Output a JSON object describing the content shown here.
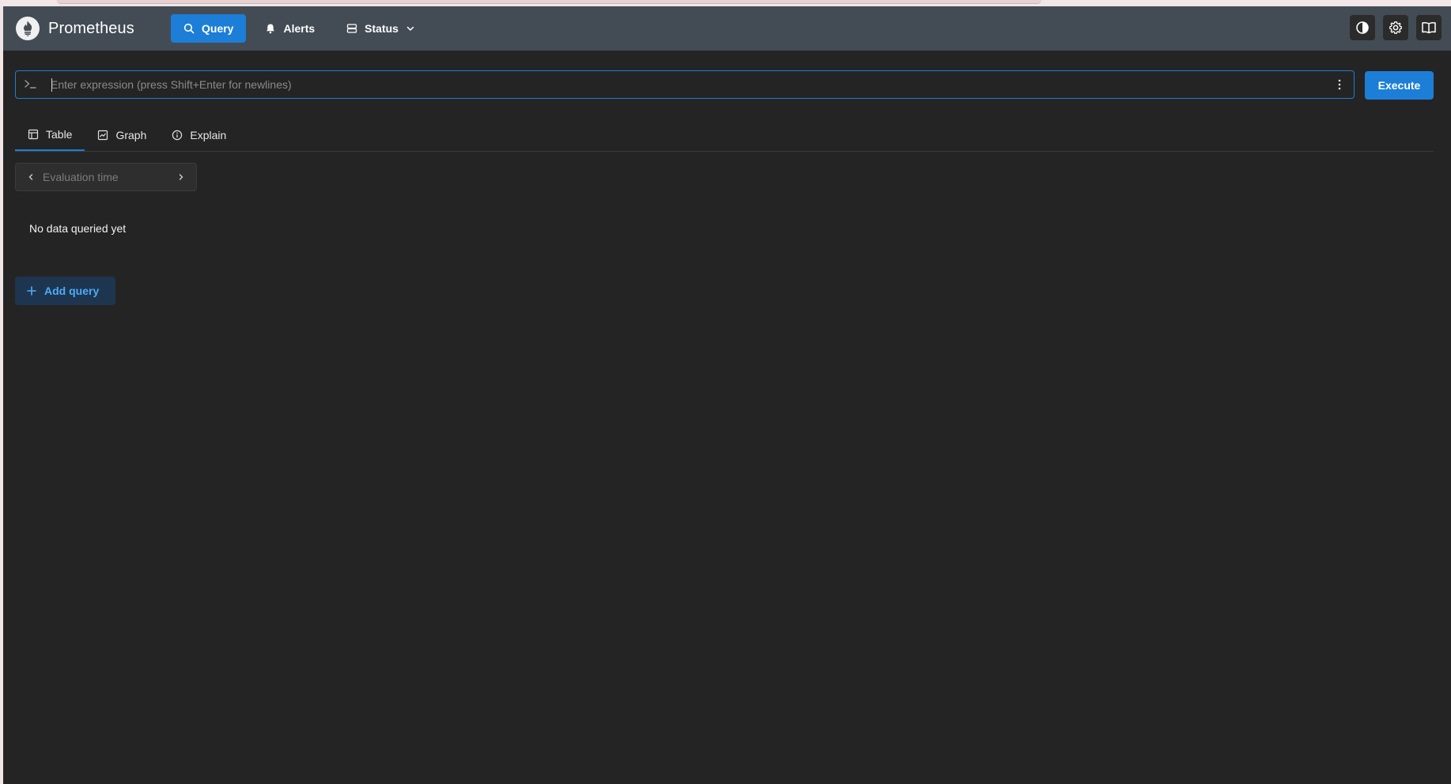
{
  "app": {
    "name": "Prometheus",
    "logo_icon": "prometheus-flame-icon"
  },
  "nav": {
    "items": [
      {
        "label": "Query",
        "icon": "search-icon",
        "active": true
      },
      {
        "label": "Alerts",
        "icon": "bell-icon",
        "active": false
      },
      {
        "label": "Status",
        "icon": "server-icon",
        "active": false,
        "dropdown": true
      }
    ]
  },
  "header_actions": [
    {
      "icon": "theme-contrast-icon"
    },
    {
      "icon": "gear-icon"
    },
    {
      "icon": "book-icon"
    }
  ],
  "expression": {
    "value": "",
    "placeholder": "Enter expression (press Shift+Enter for newlines)",
    "execute_label": "Execute"
  },
  "tabs": [
    {
      "label": "Table",
      "icon": "table-icon",
      "active": true
    },
    {
      "label": "Graph",
      "icon": "graph-icon",
      "active": false
    },
    {
      "label": "Explain",
      "icon": "info-icon",
      "active": false
    }
  ],
  "evaluation": {
    "placeholder": "Evaluation time",
    "value": ""
  },
  "status": {
    "empty_message": "No data queried yet"
  },
  "add_query_label": "Add query",
  "colors": {
    "accent": "#1c7ed6",
    "header_bg": "#434c55",
    "page_bg": "#242424",
    "add_query_text": "#4dabf7"
  }
}
